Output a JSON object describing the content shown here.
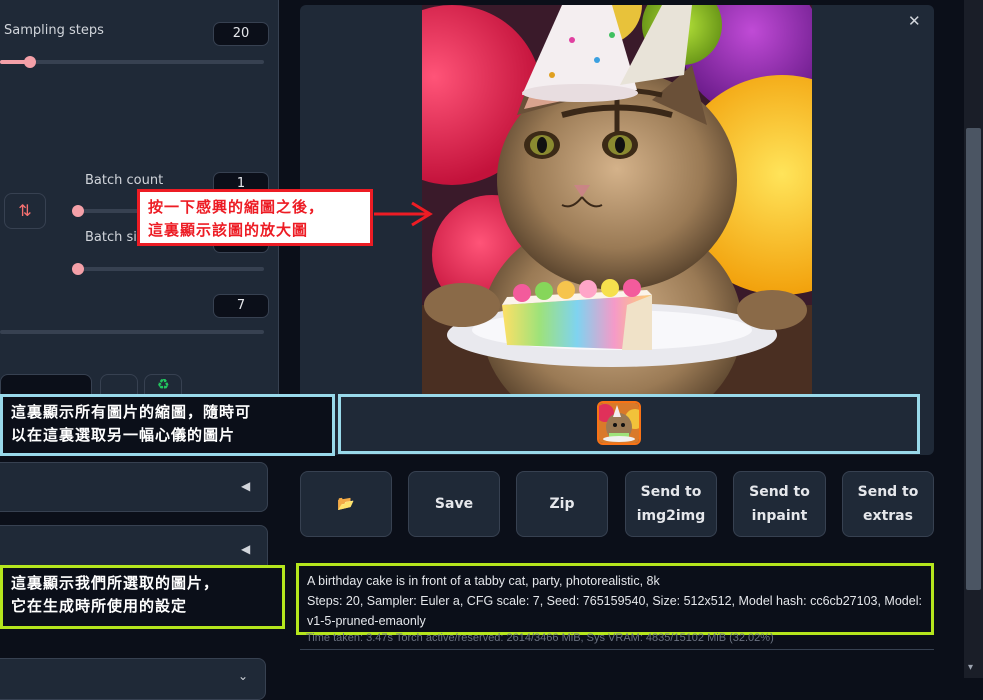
{
  "params": {
    "sampling_steps_label": "Sampling steps",
    "sampling_steps_value": "20",
    "sampling_steps_level": 0.13,
    "batch_count_label": "Batch count",
    "batch_count_value": "1",
    "batch_size_label": "Batch size",
    "cfg_value": "7",
    "swap_icon": "swap-vertical-icon"
  },
  "toolbar": {
    "folder_icon": "📂",
    "save_label": "Save",
    "zip_label": "Zip",
    "img2img_line1": "Send to",
    "img2img_line2": "img2img",
    "inpaint_line1": "Send to",
    "inpaint_line2": "inpaint",
    "extras_line1": "Send to",
    "extras_line2": "extras"
  },
  "info": {
    "prompt": "A birthday cake is in front of a tabby cat, party, photorealistic, 8k",
    "params": "Steps: 20, Sampler: Euler a, CFG scale: 7, Seed: 765159540, Size: 512x512, Model hash: cc6cb27103, Model: v1-5-pruned-emaonly",
    "time_taken": "Time taken: 3.47s  Torch active/reserved: 2614/3466 MiB, Sys VRAM: 4835/15102 MiB (32.02%)"
  },
  "annotations": {
    "red_line1": "按一下感興的縮圖之後，",
    "red_line2": "這裏顯示該圖的放大圖",
    "blue_line1": "這裏顯示所有圖片的縮圖，隨時可",
    "blue_line2": "以在這裏選取另一幅心儀的圖片",
    "green_line1": "這裏顯示我們所選取的圖片，",
    "green_line2": "它在生成時所使用的設定"
  },
  "colors": {
    "accent_slider": "#f4a0a8",
    "annotation_red": "#ed1c24",
    "annotation_blue": "#99d9ea",
    "annotation_green": "#b5e61d",
    "thumb_border": "#f97316"
  }
}
